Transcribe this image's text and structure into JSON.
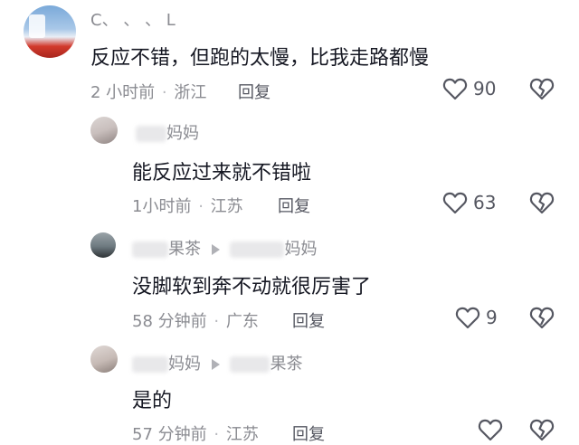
{
  "comments": [
    {
      "username": "C、 、 、 L",
      "content": "反应不错，但跑的太慢，比我走路都慢",
      "time": "2 小时前",
      "location": "浙江",
      "reply_label": "回复",
      "likes": "90"
    }
  ],
  "replies": [
    {
      "username_visible": "妈妈",
      "content": "能反应过来就不错啦",
      "time": "1小时前",
      "location": "江苏",
      "reply_label": "回复",
      "likes": "63"
    },
    {
      "username_visible": "果茶",
      "reply_to_visible": "妈妈",
      "content": "没脚软到奔不动就很厉害了",
      "time": "58 分钟前",
      "location": "广东",
      "reply_label": "回复",
      "likes": "9"
    },
    {
      "username_visible": "妈妈",
      "reply_to_visible": "果茶",
      "content": "是的",
      "time": "57 分钟前",
      "location": "江苏",
      "reply_label": "回复",
      "likes": ""
    }
  ],
  "separator": "·",
  "icons": {
    "like": "heart-outline-icon",
    "dislike": "broken-heart-icon",
    "reply_arrow": "triangle-right-icon"
  },
  "colors": {
    "text": "#161823",
    "meta": "#8a8b91",
    "icon": "#555761"
  }
}
